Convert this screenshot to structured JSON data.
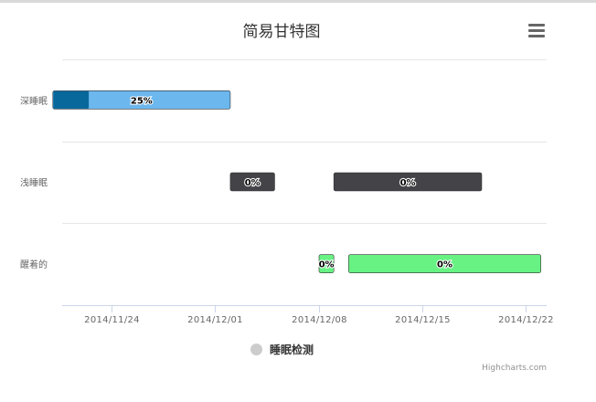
{
  "title": "简易甘特图",
  "legend_label": "睡眠检测",
  "credits": "Highcharts.com",
  "menu_icon": "hamburger-menu-icon",
  "colors": {
    "deep": "#6BB7EE",
    "deep_done": "#08679B",
    "light": "#434348",
    "awake": "#67F283",
    "grid": "#e6e6e6",
    "axis": "#ccd6eb",
    "legend_dot": "#cccccc"
  },
  "chart_data": {
    "type": "gantt",
    "title": "简易甘特图",
    "categories": [
      "深睡眠",
      "浅睡眠",
      "醒着的"
    ],
    "x_ticks": [
      "2014/11/24",
      "2014/12/01",
      "2014/12/08",
      "2014/12/15",
      "2014/12/22"
    ],
    "x_range": [
      "2014-11-20",
      "2014-12-22"
    ],
    "series": [
      {
        "name": "睡眠检测",
        "tasks": [
          {
            "category": "深睡眠",
            "start": "2014-11-20",
            "end": "2014-12-02",
            "completed": 0.25,
            "label": "25%",
            "color": "#6BB7EE"
          },
          {
            "category": "浅睡眠",
            "start": "2014-12-02",
            "end": "2014-12-05",
            "completed": 0,
            "label": "0%",
            "color": "#434348"
          },
          {
            "category": "浅睡眠",
            "start": "2014-12-09",
            "end": "2014-12-19",
            "completed": 0,
            "label": "0%",
            "color": "#434348"
          },
          {
            "category": "醒着的",
            "start": "2014-12-08",
            "end": "2014-12-09",
            "completed": 0,
            "label": "0%",
            "color": "#67F283"
          },
          {
            "category": "醒着的",
            "start": "2014-12-10",
            "end": "2014-12-23",
            "completed": 0,
            "label": "0%",
            "color": "#67F283"
          }
        ]
      }
    ],
    "grid": true,
    "legend_position": "bottom"
  }
}
